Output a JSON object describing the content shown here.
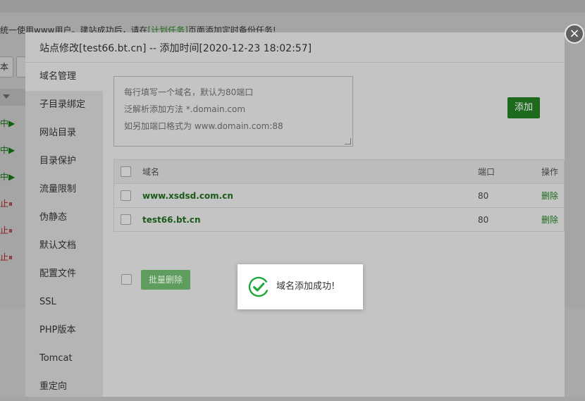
{
  "background": {
    "notice_prefix": "统一使用www用户。建站成功后，请在",
    "notice_link": "[计划任务]",
    "notice_suffix": "页面添加定时备份任务!",
    "toolbar_btn_1": "本",
    "status_running": "中▶",
    "status_stopped": "止⏸"
  },
  "modal": {
    "title": "站点修改[test66.bt.cn] -- 添加时间[2020-12-23 18:02:57]",
    "close_label": "×",
    "nav": [
      "域名管理",
      "子目录绑定",
      "网站目录",
      "目录保护",
      "流量限制",
      "伪静态",
      "默认文档",
      "配置文件",
      "SSL",
      "PHP版本",
      "Tomcat",
      "重定向"
    ],
    "textarea_placeholder": [
      "每行填写一个域名，默认为80端口",
      "泛解析添加方法 *.domain.com",
      "如另加端口格式为 www.domain.com:88"
    ],
    "add_button": "添加",
    "table": {
      "headers": {
        "name": "域名",
        "port": "端口",
        "op": "操作"
      },
      "rows": [
        {
          "name": "www.xsdsd.com.cn",
          "port": "80",
          "op": "删除"
        },
        {
          "name": "test66.bt.cn",
          "port": "80",
          "op": "删除"
        }
      ]
    },
    "batch_delete_button": "批量删除"
  },
  "toast": {
    "message": "域名添加成功!",
    "icon": "check-circle-icon"
  },
  "colors": {
    "accent_green": "#20a53a",
    "toast_check": "#20a53a"
  }
}
